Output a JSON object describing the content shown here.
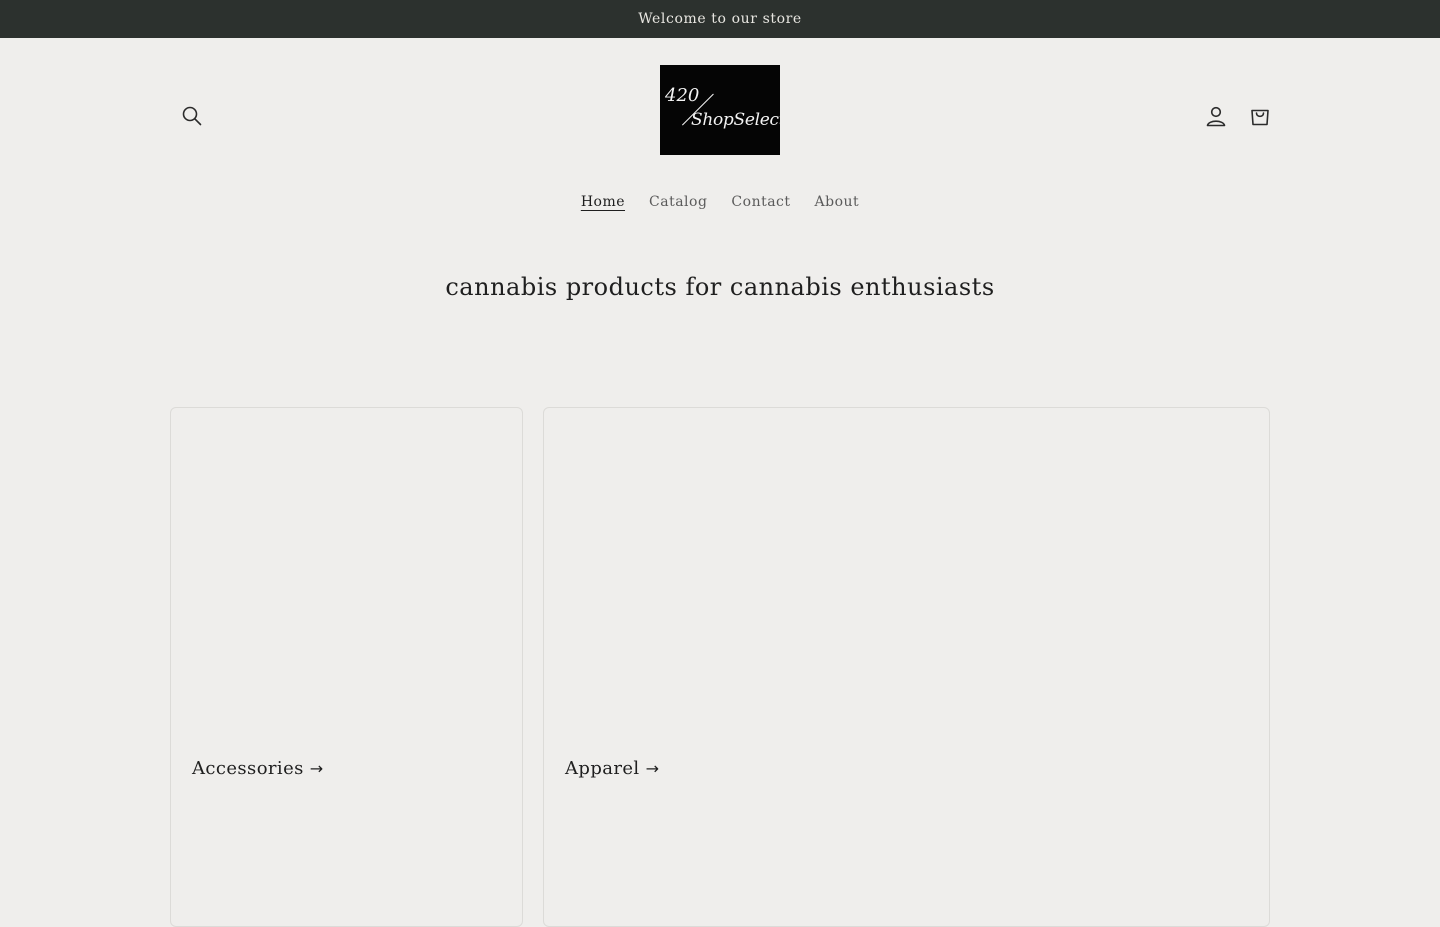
{
  "announcement": {
    "text": "Welcome to our store"
  },
  "header": {
    "logo": {
      "line1": "420",
      "line2": "ShopSelect"
    },
    "icons": {
      "search": "search-icon",
      "account": "user-icon",
      "cart": "cart-icon"
    }
  },
  "nav": {
    "items": [
      {
        "label": "Home",
        "active": true
      },
      {
        "label": "Catalog",
        "active": false
      },
      {
        "label": "Contact",
        "active": false
      },
      {
        "label": "About",
        "active": false
      }
    ]
  },
  "hero": {
    "title": "cannabis products for cannabis enthusiasts"
  },
  "collections": [
    {
      "label": "Accessories",
      "arrow": "→"
    },
    {
      "label": "Apparel",
      "arrow": "→"
    }
  ],
  "colors": {
    "background": "#efeeec",
    "announcement_bg": "#2c312e",
    "announcement_text": "#e8e6e1",
    "logo_bg": "#050505",
    "text": "#1f1f1f"
  }
}
